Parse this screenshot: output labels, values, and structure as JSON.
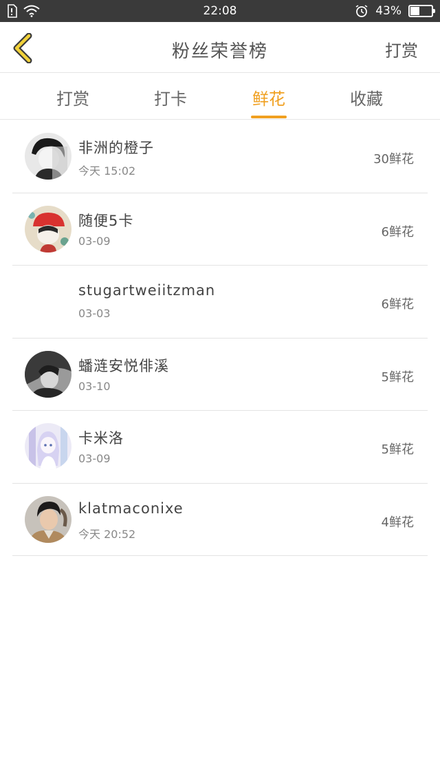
{
  "status_bar": {
    "time": "22:08",
    "battery": "43%",
    "battery_level": 0.43
  },
  "header": {
    "title": "粉丝荣誉榜",
    "right_action": "打赏"
  },
  "tabs": [
    "打赏",
    "打卡",
    "鲜花",
    "收藏"
  ],
  "active_tab": 2,
  "colors": {
    "accent": "#f0a020"
  },
  "fans": [
    {
      "name": "非洲的橙子",
      "time": "今天 15:02",
      "count": "30鲜花",
      "avatar": "dark-hair-avatar"
    },
    {
      "name": "随便5卡",
      "time": "03-09",
      "count": "6鲜花",
      "avatar": "red-hat-avatar"
    },
    {
      "name": "stugartweiitzman",
      "time": "03-03",
      "count": "6鲜花",
      "avatar": "blank-avatar"
    },
    {
      "name": "蟠涟安悦俳溪",
      "time": "03-10",
      "count": "5鲜花",
      "avatar": "bw-photo-avatar"
    },
    {
      "name": "卡米洛",
      "time": "03-09",
      "count": "5鲜花",
      "avatar": "anime-girl-avatar"
    },
    {
      "name": "klatmaconixe",
      "time": "今天 20:52",
      "count": "4鲜花",
      "avatar": "man-photo-avatar"
    }
  ]
}
